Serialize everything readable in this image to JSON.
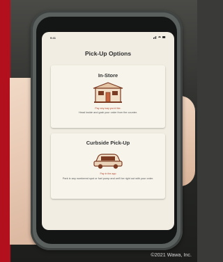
{
  "status_bar": {
    "time": "9:41",
    "indicators": "signal wifi battery"
  },
  "screen": {
    "title": "Pick-Up Options"
  },
  "options": [
    {
      "title": "In-Store",
      "icon": "store-icon",
      "note": "Pay any way you'd like.",
      "description": "Head inside and grab your order from the counter."
    },
    {
      "title": "Curbside Pick-Up",
      "icon": "car-icon",
      "note": "Pay in the app",
      "description": "Park in any numbered spot or fuel pump and we'll be right out with your order."
    }
  ],
  "footer": {
    "copyright": "©2021 Wawa, Inc."
  },
  "colors": {
    "brand_red": "#b3101e",
    "screen_bg": "#f1ede2",
    "accent": "#b34a2f"
  }
}
